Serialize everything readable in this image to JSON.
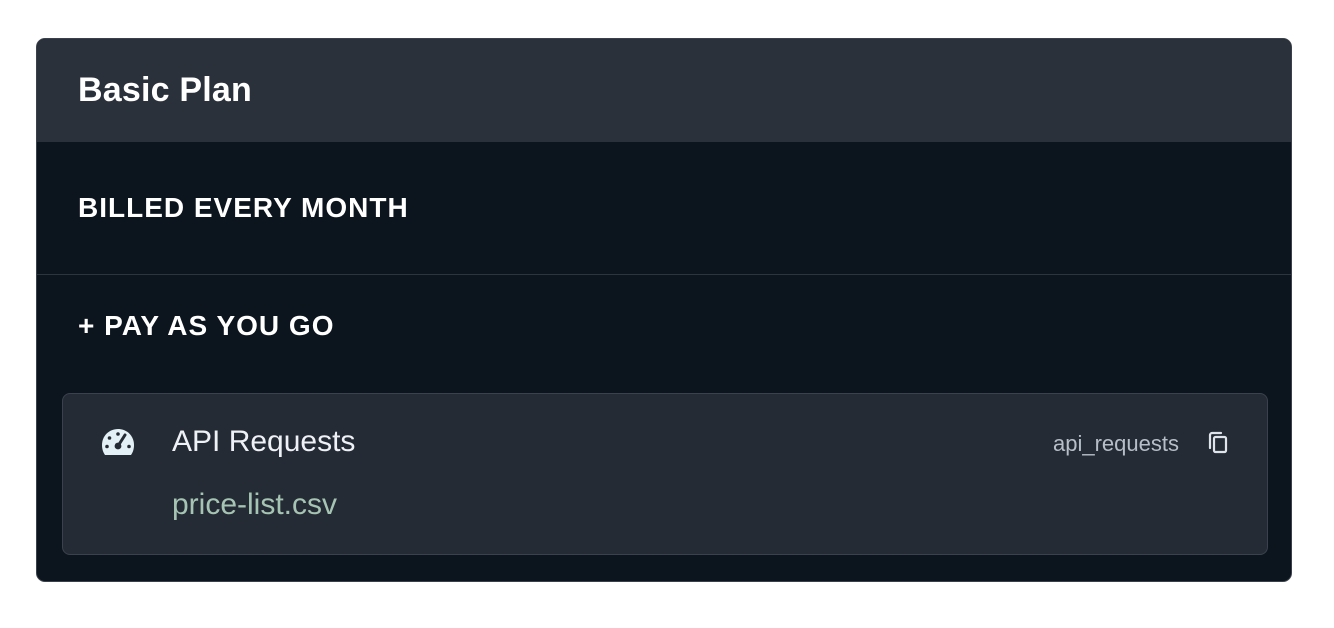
{
  "plan": {
    "title": "Basic Plan"
  },
  "billing": {
    "section_label": "BILLED EVERY MONTH"
  },
  "payg": {
    "section_label": "+ PAY AS YOU GO"
  },
  "meter": {
    "name": "API Requests",
    "file": "price-list.csv",
    "key": "api_requests",
    "icon": "gauge-icon",
    "copy_icon": "copy-icon"
  },
  "colors": {
    "header_bg": "#2b313b",
    "card_bg": "#0c141d",
    "meter_bg": "#252b35",
    "file_text": "#a6c4b3",
    "icon_fill": "#e3f0f5"
  }
}
